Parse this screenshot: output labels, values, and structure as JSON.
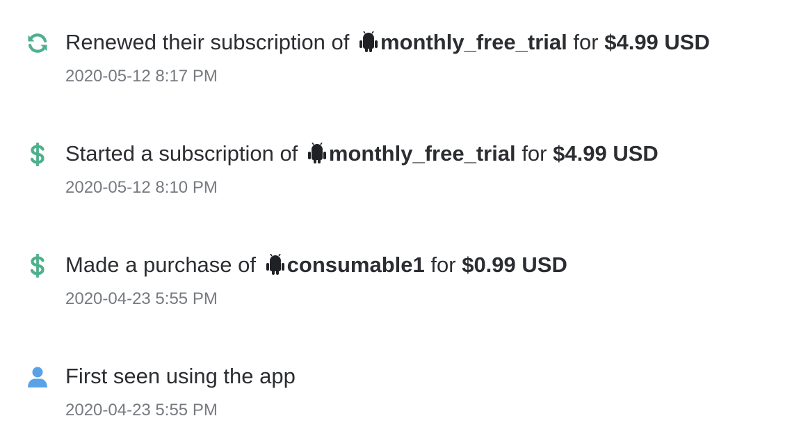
{
  "colors": {
    "renew_icon": "#4fb08d",
    "dollar_icon": "#4fb08d",
    "user_icon": "#5aa2e8",
    "text_primary": "#2b2d31",
    "text_secondary": "#767a80"
  },
  "events": [
    {
      "icon": "renew-icon",
      "prefix": "Renewed their subscription of",
      "platform_icon": "android-icon",
      "product": "monthly_free_trial",
      "connector": "for",
      "price": "$4.99 USD",
      "timestamp": "2020-05-12 8:17 PM"
    },
    {
      "icon": "dollar-icon",
      "prefix": "Started a subscription of",
      "platform_icon": "android-icon",
      "product": "monthly_free_trial",
      "connector": "for",
      "price": "$4.99 USD",
      "timestamp": "2020-05-12 8:10 PM"
    },
    {
      "icon": "dollar-icon",
      "prefix": "Made a purchase of",
      "platform_icon": "android-icon",
      "product": "consumable1",
      "connector": "for",
      "price": "$0.99 USD",
      "timestamp": "2020-04-23 5:55 PM"
    },
    {
      "icon": "user-icon",
      "prefix": "First seen using the app",
      "timestamp": "2020-04-23 5:55 PM"
    }
  ]
}
